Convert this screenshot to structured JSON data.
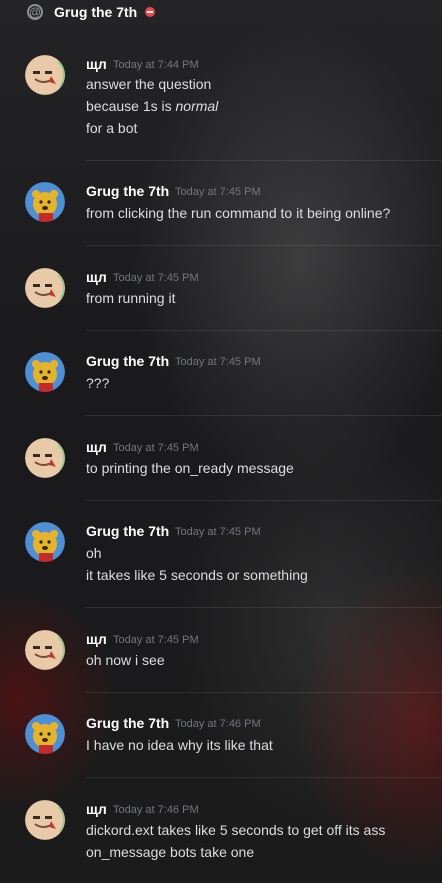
{
  "header": {
    "channel_name": "Grug the 7th",
    "at_icon": "at-sign-icon",
    "status_icon": "do-not-disturb-icon"
  },
  "messages": [
    {
      "author": "щл",
      "timestamp": "Today at 7:44 PM",
      "avatar": "face-avatar",
      "lines": [
        "answer the question",
        "because 1s is ",
        "for a bot"
      ],
      "emphasis": "normal"
    },
    {
      "author": "Grug the 7th",
      "timestamp": "Today at 7:45 PM",
      "avatar": "bear-avatar",
      "lines": [
        "from clicking the run command to it being online?"
      ]
    },
    {
      "author": "щл",
      "timestamp": "Today at 7:45 PM",
      "avatar": "face-avatar",
      "lines": [
        "from running it"
      ]
    },
    {
      "author": "Grug the 7th",
      "timestamp": "Today at 7:45 PM",
      "avatar": "bear-avatar",
      "lines": [
        "???"
      ]
    },
    {
      "author": "щл",
      "timestamp": "Today at 7:45 PM",
      "avatar": "face-avatar",
      "lines": [
        "to printing the on_ready message"
      ]
    },
    {
      "author": "Grug the 7th",
      "timestamp": "Today at 7:45 PM",
      "avatar": "bear-avatar",
      "lines": [
        "oh",
        "it takes like 5 seconds or something"
      ]
    },
    {
      "author": "щл",
      "timestamp": "Today at 7:45 PM",
      "avatar": "face-avatar",
      "lines": [
        "oh now i see"
      ]
    },
    {
      "author": "Grug the 7th",
      "timestamp": "Today at 7:46 PM",
      "avatar": "bear-avatar",
      "lines": [
        "I have no idea why its like that"
      ]
    },
    {
      "author": "щл",
      "timestamp": "Today at 7:46 PM",
      "avatar": "face-avatar",
      "lines": [
        "dickord.ext takes like 5 seconds to get off its ass",
        "on_message bots take one"
      ]
    }
  ],
  "colors": {
    "username": "#ffffff",
    "text": "#dcddde",
    "timestamp": "#72767d",
    "dnd": "#f04747"
  }
}
